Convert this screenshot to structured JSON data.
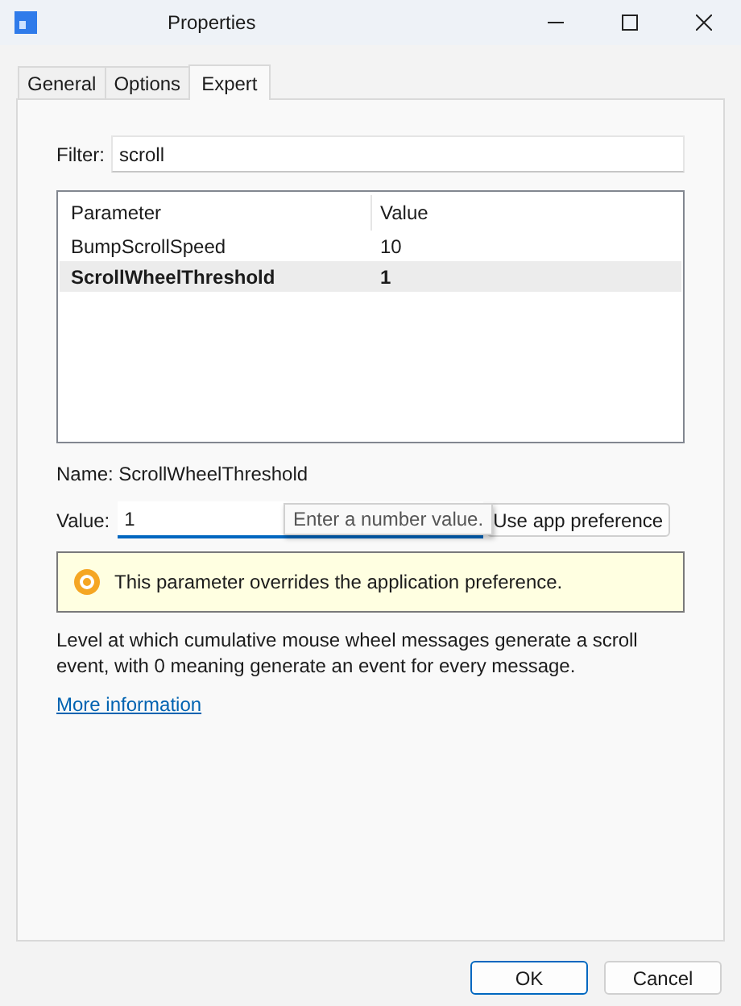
{
  "window": {
    "title": "Properties"
  },
  "tabs": [
    {
      "label": "General",
      "selected": false
    },
    {
      "label": "Options",
      "selected": false
    },
    {
      "label": "Expert",
      "selected": true
    }
  ],
  "filter": {
    "label": "Filter:",
    "value": "scroll"
  },
  "table": {
    "columns": [
      "Parameter",
      "Value"
    ],
    "rows": [
      {
        "parameter": "BumpScrollSpeed",
        "value": "10",
        "selected": false
      },
      {
        "parameter": "ScrollWheelThreshold",
        "value": "1",
        "selected": true
      }
    ]
  },
  "name": "Name: ScrollWheelThreshold",
  "value_field": {
    "label": "Value:",
    "value": "1",
    "focused": true,
    "tooltip": "Enter a number value."
  },
  "app_pref_button": "Use app preference",
  "notice": "This parameter overrides the application preference.",
  "description": "Level at which cumulative mouse wheel messages generate a scroll event, with 0 meaning generate an event for every message.",
  "link": "More information",
  "buttons": [
    {
      "label": "OK",
      "default": true
    },
    {
      "label": "Cancel",
      "default": false
    }
  ]
}
